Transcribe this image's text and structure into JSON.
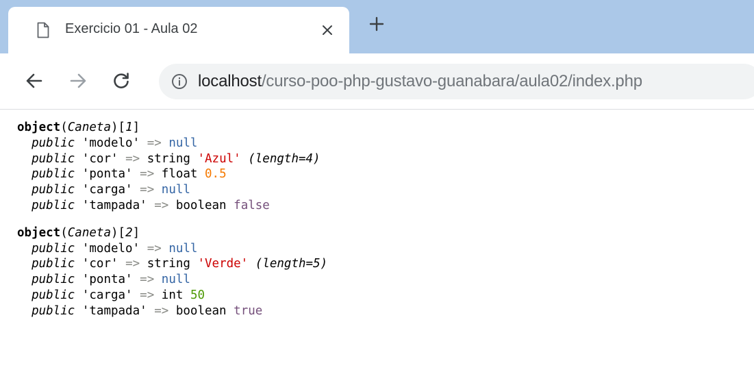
{
  "browser": {
    "tab": {
      "title": "Exercicio 01 - Aula 02",
      "page_icon": "document-icon",
      "close_icon": "close-icon"
    },
    "new_tab_icon": "plus-icon",
    "toolbar": {
      "back_icon": "arrow-left-icon",
      "forward_icon": "arrow-right-icon",
      "reload_icon": "reload-icon",
      "info_icon": "info-icon"
    },
    "url": {
      "host": "localhost",
      "path": "/curso-poo-php-gustavo-guanabara/aula02/index.php"
    }
  },
  "dump": {
    "objects": [
      {
        "keyword": "object",
        "class_name": "Caneta",
        "index": "1",
        "properties": [
          {
            "visibility": "public",
            "name": "'modelo'",
            "arrow": "=>",
            "type": "",
            "value": "null",
            "value_kind": "null",
            "length": ""
          },
          {
            "visibility": "public",
            "name": "'cor'",
            "arrow": "=>",
            "type": "string",
            "value": "'Azul'",
            "value_kind": "string",
            "length": "(length=4)"
          },
          {
            "visibility": "public",
            "name": "'ponta'",
            "arrow": "=>",
            "type": "float",
            "value": "0.5",
            "value_kind": "float",
            "length": ""
          },
          {
            "visibility": "public",
            "name": "'carga'",
            "arrow": "=>",
            "type": "",
            "value": "null",
            "value_kind": "null",
            "length": ""
          },
          {
            "visibility": "public",
            "name": "'tampada'",
            "arrow": "=>",
            "type": "boolean",
            "value": "false",
            "value_kind": "boolean",
            "length": ""
          }
        ]
      },
      {
        "keyword": "object",
        "class_name": "Caneta",
        "index": "2",
        "properties": [
          {
            "visibility": "public",
            "name": "'modelo'",
            "arrow": "=>",
            "type": "",
            "value": "null",
            "value_kind": "null",
            "length": ""
          },
          {
            "visibility": "public",
            "name": "'cor'",
            "arrow": "=>",
            "type": "string",
            "value": "'Verde'",
            "value_kind": "string",
            "length": "(length=5)"
          },
          {
            "visibility": "public",
            "name": "'ponta'",
            "arrow": "=>",
            "type": "",
            "value": "null",
            "value_kind": "null",
            "length": ""
          },
          {
            "visibility": "public",
            "name": "'carga'",
            "arrow": "=>",
            "type": "int",
            "value": "50",
            "value_kind": "int",
            "length": ""
          },
          {
            "visibility": "public",
            "name": "'tampada'",
            "arrow": "=>",
            "type": "boolean",
            "value": "true",
            "value_kind": "boolean",
            "length": ""
          }
        ]
      }
    ]
  },
  "colors": {
    "tabstrip_bg": "#abc8e8",
    "omnibox_bg": "#f1f3f4",
    "null": "#3465a4",
    "string": "#cc0000",
    "float": "#f57900",
    "int": "#4e9a06",
    "boolean": "#75507b",
    "arrow": "#888a85"
  }
}
